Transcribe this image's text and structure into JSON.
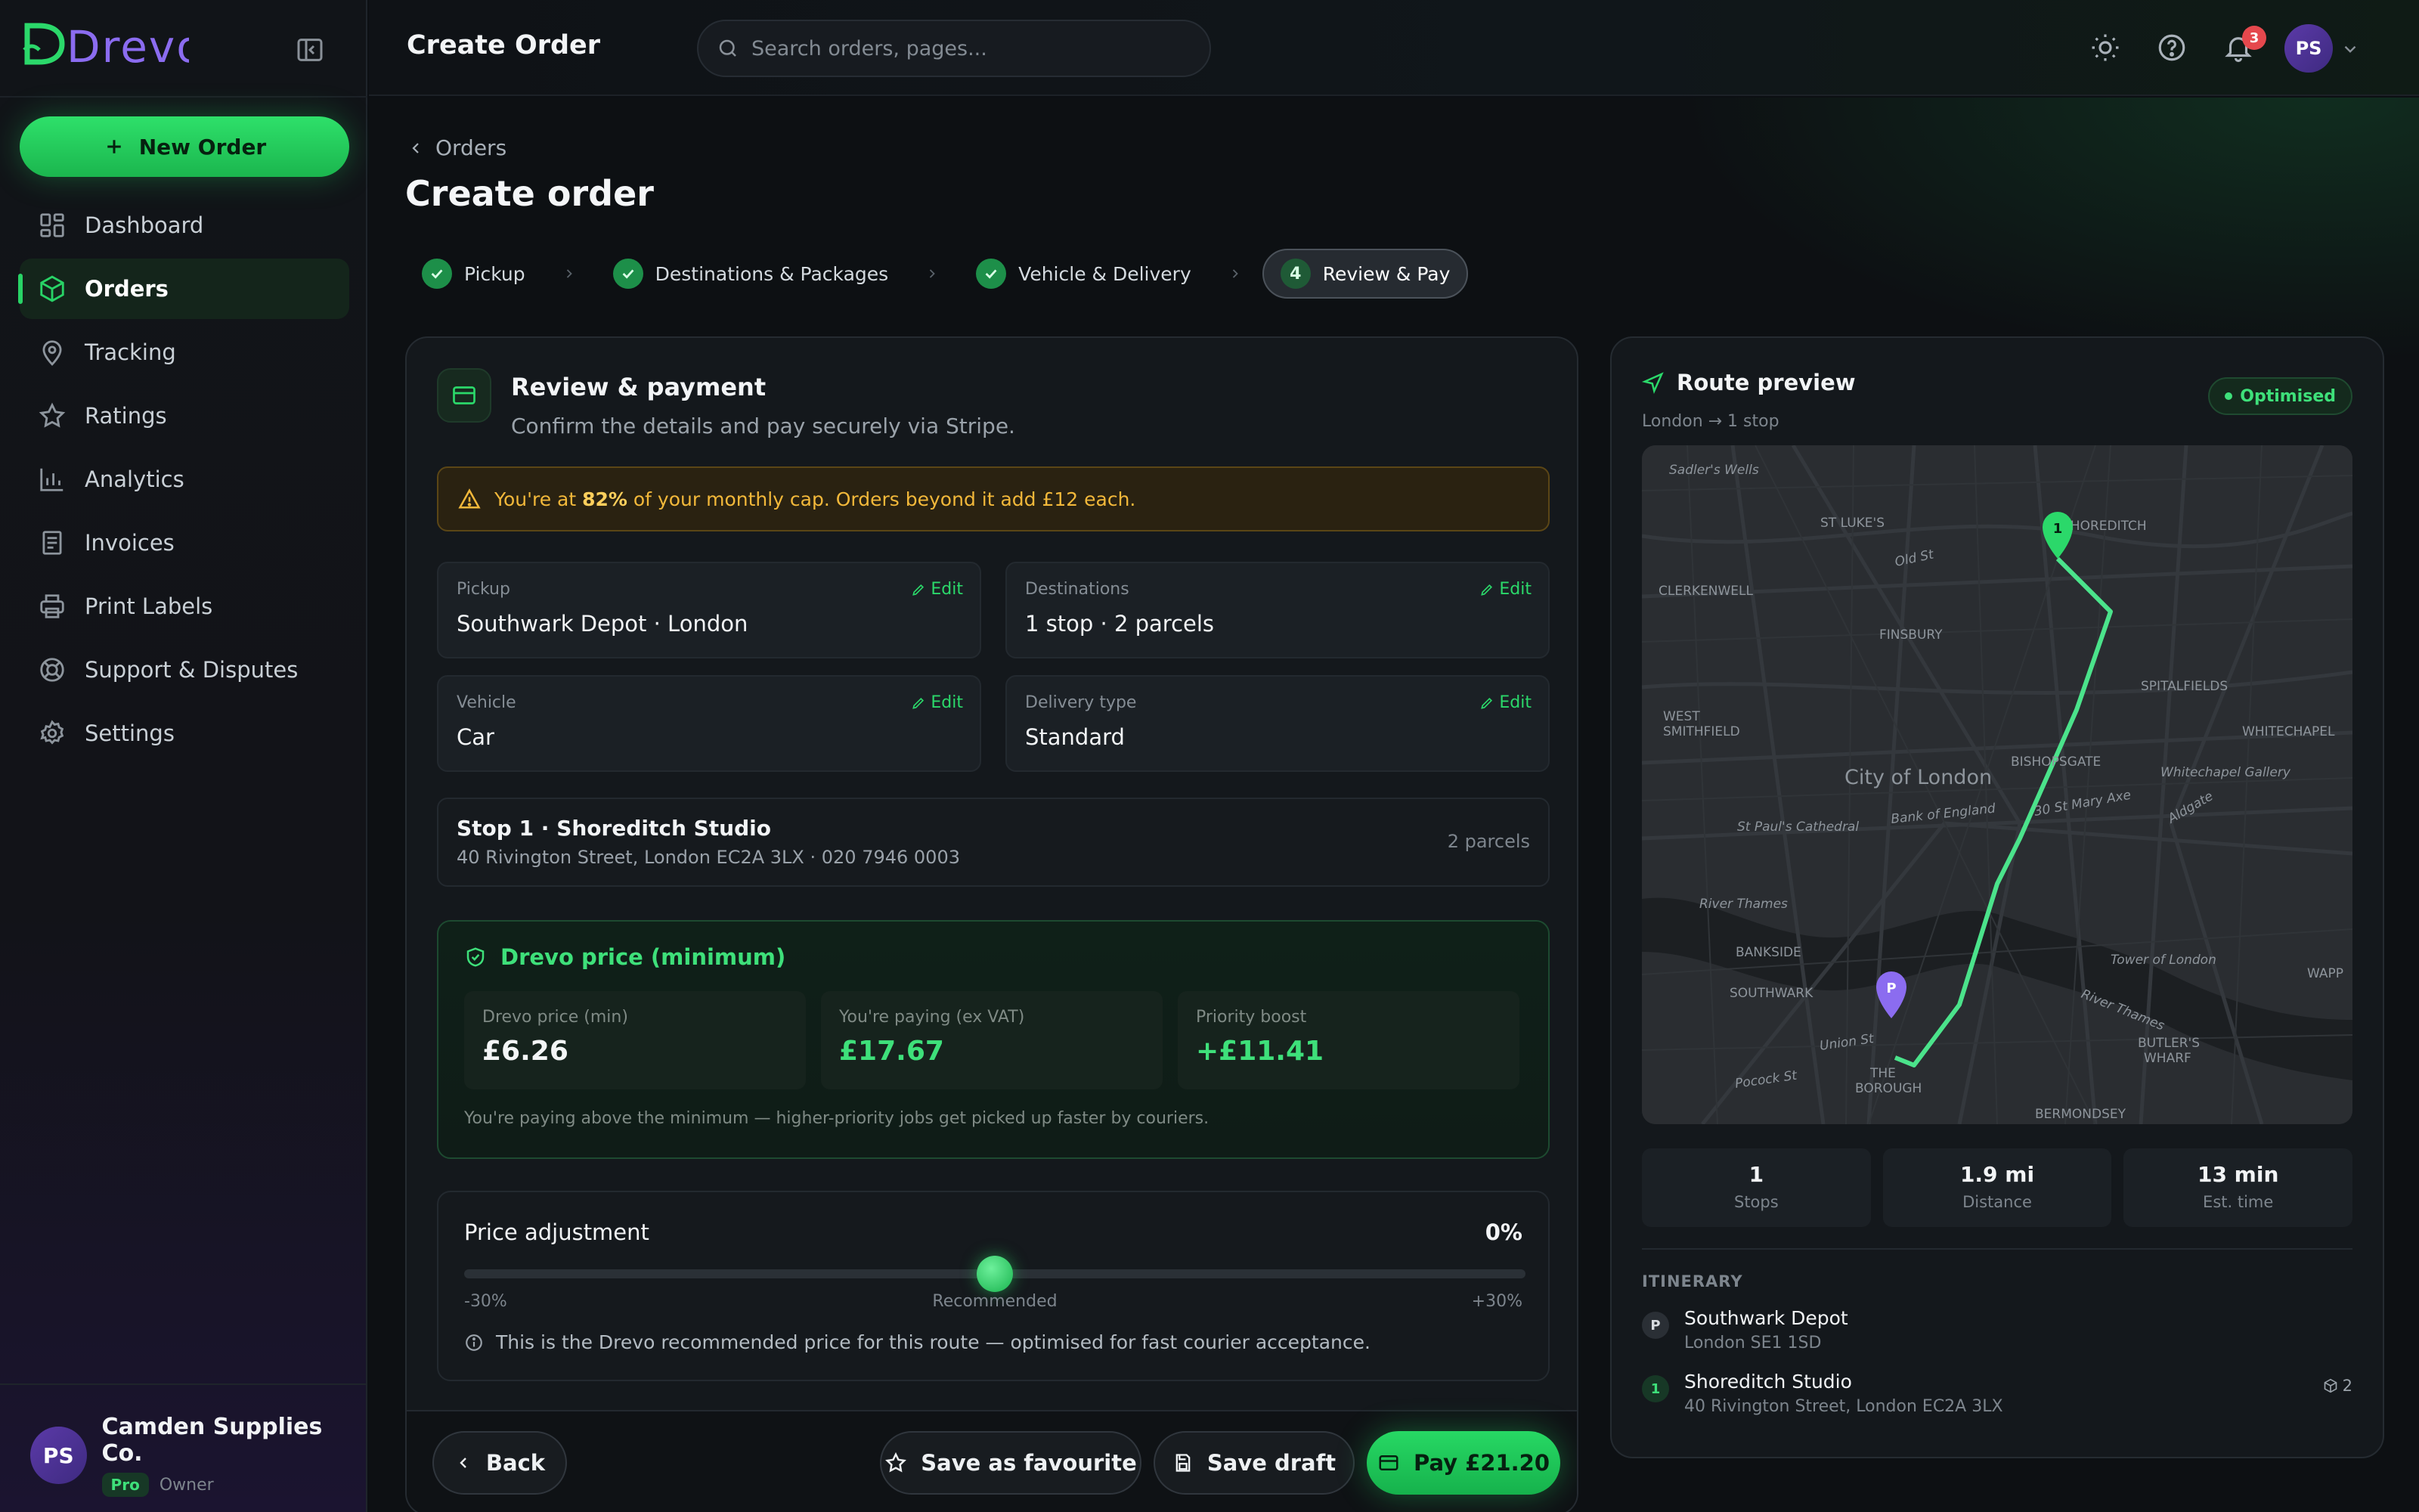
{
  "app": {
    "brand": "Drevo",
    "accent": "#22c55e"
  },
  "sidebar": {
    "new_order_label": "New Order",
    "items": [
      {
        "label": "Dashboard",
        "icon": "dashboard-icon"
      },
      {
        "label": "Orders",
        "icon": "box-icon",
        "active": true
      },
      {
        "label": "Tracking",
        "icon": "map-pin-icon"
      },
      {
        "label": "Ratings",
        "icon": "star-icon"
      },
      {
        "label": "Analytics",
        "icon": "bar-chart-icon"
      },
      {
        "label": "Invoices",
        "icon": "invoice-icon"
      },
      {
        "label": "Print Labels",
        "icon": "printer-icon"
      },
      {
        "label": "Support & Disputes",
        "icon": "lifebuoy-icon"
      },
      {
        "label": "Settings",
        "icon": "gear-icon"
      }
    ],
    "user": {
      "initials": "PS",
      "org": "Camden Supplies Co.",
      "plan": "Pro",
      "role": "Owner"
    }
  },
  "header": {
    "title": "Create Order",
    "search_placeholder": "Search orders, pages...",
    "notifications_count": "3",
    "avatar_initials": "PS"
  },
  "main": {
    "breadcrumb": "Orders",
    "title": "Create order",
    "steps": [
      {
        "label": "Pickup",
        "status": "done"
      },
      {
        "label": "Destinations & Packages",
        "status": "done"
      },
      {
        "label": "Vehicle & Delivery",
        "status": "done"
      },
      {
        "label": "Review & Pay",
        "status": "current",
        "number": "4"
      }
    ]
  },
  "review": {
    "title": "Review & payment",
    "subtitle": "Confirm the details and pay securely via Stripe.",
    "warning_pre": "You're at ",
    "warning_pct": "82%",
    "warning_post": " of your monthly cap. Orders beyond it add £12 each.",
    "edit_label": "Edit",
    "pickup": {
      "label": "Pickup",
      "value": "Southwark Depot · London"
    },
    "destinations": {
      "label": "Destinations",
      "value": "1 stop · 2 parcels"
    },
    "vehicle": {
      "label": "Vehicle",
      "value": "Car"
    },
    "delivery_type": {
      "label": "Delivery type",
      "value": "Standard"
    },
    "stop": {
      "title": "Stop 1 · Shoreditch Studio",
      "address": "40 Rivington Street, London EC2A 3LX · 020 7946 0003",
      "parcels": "2 parcels"
    }
  },
  "price": {
    "title": "Drevo price (minimum)",
    "min_label": "Drevo price (min)",
    "min_value": "£6.26",
    "paying_label": "You're paying (ex VAT)",
    "paying_value": "£17.67",
    "boost_label": "Priority boost",
    "boost_value": "+£11.41",
    "note": "You're paying above the minimum — higher-priority jobs get picked up faster by couriers."
  },
  "adjustment": {
    "title": "Price adjustment",
    "value": "0%",
    "slider_fraction": 0.5,
    "min_label": "-30%",
    "mid_label": "Recommended",
    "max_label": "+30%",
    "info": "This is the Drevo recommended price for this route — optimised for fast courier acceptance."
  },
  "footer": {
    "back": "Back",
    "favourite": "Save as favourite",
    "draft": "Save draft",
    "pay": "Pay £21.20"
  },
  "route": {
    "title": "Route preview",
    "subtitle": "London → 1 stop",
    "badge": "Optimised",
    "map_labels": [
      "Sadler's Wells",
      "ST LUKE'S",
      "SHOREDITCH",
      "CLERKENWELL",
      "Old St",
      "FINSBURY",
      "WEST",
      "SMITHFIELD",
      "City of London",
      "BISHOPSGATE",
      "SPITALFIELDS",
      "WHITECHAPEL",
      "Whitechapel Gallery",
      "St Paul's Cathedral",
      "Bank of England",
      "30 St Mary Axe",
      "Aldgate",
      "River Thames",
      "BANKSIDE",
      "SOUTHWARK",
      "Tower of London",
      "River Thames",
      "WAPP",
      "Union St",
      "THE",
      "BOROUGH",
      "BUTLER'S",
      "WHARF",
      "Pocock St",
      "BERMONDSEY"
    ],
    "pickup_marker": "P",
    "stop_marker": "1",
    "stats": [
      {
        "value": "1",
        "label": "Stops"
      },
      {
        "value": "1.9 mi",
        "label": "Distance"
      },
      {
        "value": "13 min",
        "label": "Est. time"
      }
    ],
    "itinerary_title": "ITINERARY",
    "itinerary": [
      {
        "marker": "P",
        "name": "Southwark Depot",
        "address": "London SE1 1SD"
      },
      {
        "marker": "1",
        "name": "Shoreditch Studio",
        "address": "40 Rivington Street, London EC2A 3LX",
        "parcels": "2"
      }
    ]
  }
}
